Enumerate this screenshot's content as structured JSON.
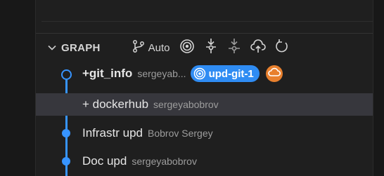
{
  "graph": {
    "title": "GRAPH",
    "auto_label": "Auto",
    "commits": [
      {
        "message": "+git_info",
        "author": "sergeyab...",
        "branch": "upd-git-1",
        "selected": false
      },
      {
        "message": "+ dockerhub",
        "author": "sergeyabobrov",
        "selected": true
      },
      {
        "message": "Infrastr upd",
        "author": "Bobrov Sergey",
        "selected": false
      },
      {
        "message": "Doc upd",
        "author": "sergeyabobrov",
        "selected": false
      }
    ]
  },
  "colors": {
    "lane": "#3794ff",
    "branch_badge": "#2f8cf3",
    "remote_badge": "#e8802e",
    "selected_row": "#37373d"
  },
  "icons": {
    "collapse": "chevron-down-icon",
    "branch_filter": "source-control-icon",
    "target": "target-icon",
    "fetch": "fetch-icon",
    "pull": "pull-icon",
    "push": "cloud-upload-icon",
    "refresh": "refresh-icon",
    "branch": "target-icon",
    "remote": "cloud-icon"
  }
}
